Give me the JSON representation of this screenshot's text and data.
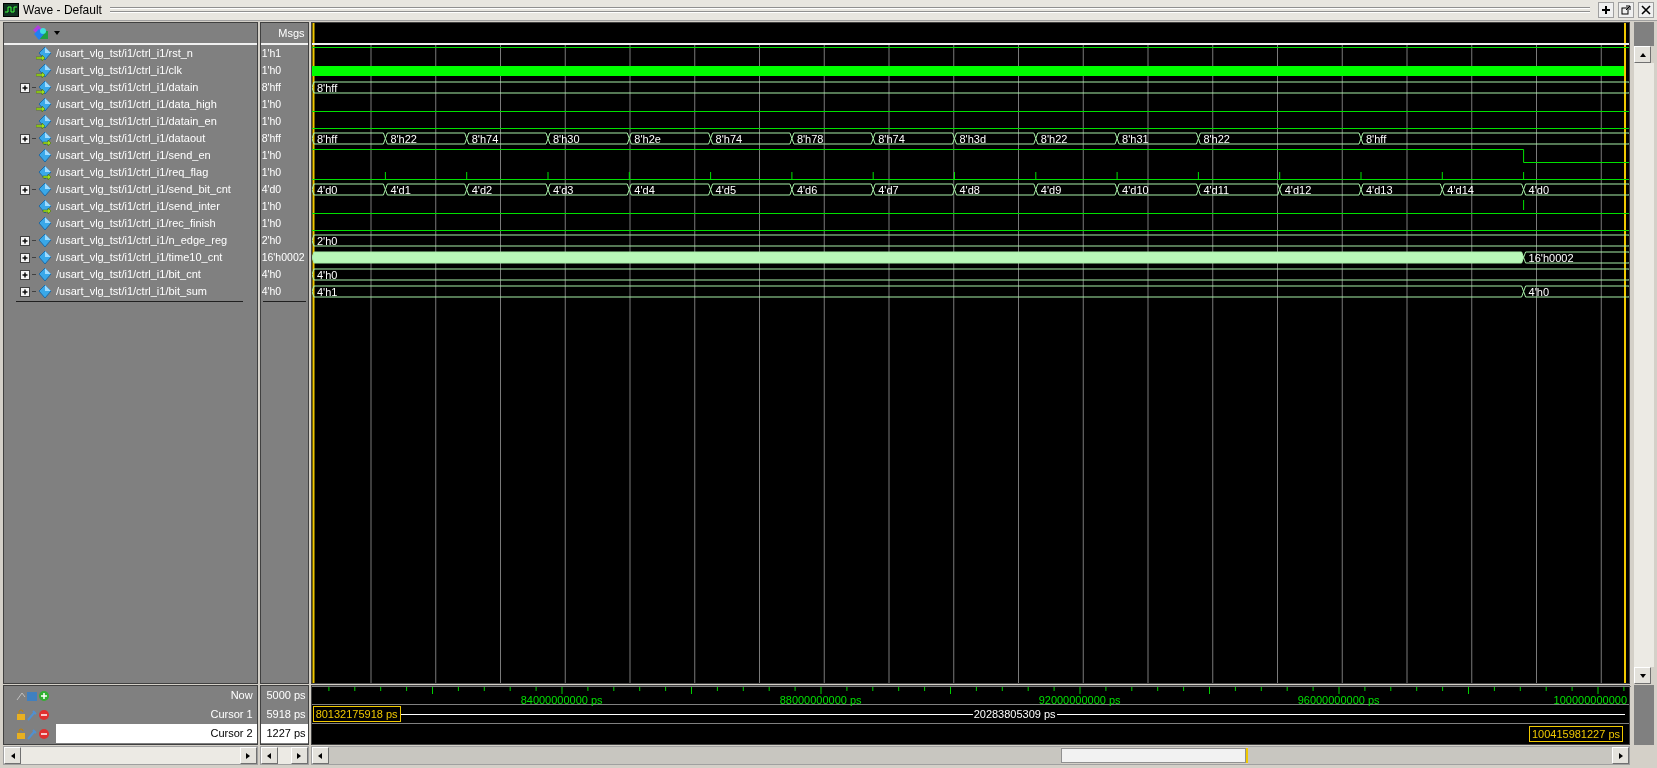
{
  "window": {
    "title": "Wave - Default"
  },
  "header": {
    "values_label": "Msgs"
  },
  "signals": [
    {
      "name": "/usart_vlg_tst/i1/ctrl_i1/rst_n",
      "value": "1'h1",
      "input": true,
      "output": false,
      "kind": "high"
    },
    {
      "name": "/usart_vlg_tst/i1/ctrl_i1/clk",
      "value": "1'h0",
      "input": true,
      "output": false,
      "kind": "clock"
    },
    {
      "name": "/usart_vlg_tst/i1/ctrl_i1/datain",
      "value": "8'hff",
      "input": true,
      "output": false,
      "kind": "bus",
      "expanded": false,
      "segments": [
        {
          "label": "8'hff"
        }
      ]
    },
    {
      "name": "/usart_vlg_tst/i1/ctrl_i1/data_high",
      "value": "1'h0",
      "input": true,
      "output": false,
      "kind": "low"
    },
    {
      "name": "/usart_vlg_tst/i1/ctrl_i1/datain_en",
      "value": "1'h0",
      "input": true,
      "output": false,
      "kind": "low"
    },
    {
      "name": "/usart_vlg_tst/i1/ctrl_i1/dataout",
      "value": "8'hff",
      "input": false,
      "output": true,
      "kind": "bus",
      "expanded": false,
      "segments": [
        {
          "label": "8'hff"
        },
        {
          "label": "8'h22"
        },
        {
          "label": "8'h74"
        },
        {
          "label": "8'h30"
        },
        {
          "label": "8'h2e"
        },
        {
          "label": "8'h74"
        },
        {
          "label": "8'h78"
        },
        {
          "label": "8'h74"
        },
        {
          "label": "8'h3d"
        },
        {
          "label": "8'h22"
        },
        {
          "label": "8'h31"
        },
        {
          "label": "8'h22"
        },
        {
          "label": "8'hff"
        }
      ]
    },
    {
      "name": "/usart_vlg_tst/i1/ctrl_i1/send_en",
      "value": "1'h0",
      "input": false,
      "output": false,
      "kind": "fall"
    },
    {
      "name": "/usart_vlg_tst/i1/ctrl_i1/req_flag",
      "value": "1'h0",
      "input": false,
      "output": true,
      "kind": "pulses"
    },
    {
      "name": "/usart_vlg_tst/i1/ctrl_i1/send_bit_cnt",
      "value": "4'd0",
      "input": false,
      "output": false,
      "kind": "bus",
      "expanded": false,
      "segments": [
        {
          "label": "4'd0"
        },
        {
          "label": "4'd1"
        },
        {
          "label": "4'd2"
        },
        {
          "label": "4'd3"
        },
        {
          "label": "4'd4"
        },
        {
          "label": "4'd5"
        },
        {
          "label": "4'd6"
        },
        {
          "label": "4'd7"
        },
        {
          "label": "4'd8"
        },
        {
          "label": "4'd9"
        },
        {
          "label": "4'd10"
        },
        {
          "label": "4'd11"
        },
        {
          "label": "4'd12"
        },
        {
          "label": "4'd13"
        },
        {
          "label": "4'd14"
        },
        {
          "label": "4'd0"
        }
      ]
    },
    {
      "name": "/usart_vlg_tst/i1/ctrl_i1/send_inter",
      "value": "1'h0",
      "input": false,
      "output": true,
      "kind": "blip"
    },
    {
      "name": "/usart_vlg_tst/i1/ctrl_i1/rec_finish",
      "value": "1'h0",
      "input": false,
      "output": false,
      "kind": "low"
    },
    {
      "name": "/usart_vlg_tst/i1/ctrl_i1/n_edge_reg",
      "value": "2'h0",
      "input": false,
      "output": false,
      "kind": "bus",
      "expanded": false,
      "segments": [
        {
          "label": "2'h0"
        }
      ]
    },
    {
      "name": "/usart_vlg_tst/i1/ctrl_i1/time10_cnt",
      "value": "16'h0002",
      "input": false,
      "output": false,
      "kind": "bus",
      "expanded": false,
      "segments": [
        {
          "kind": "dense"
        },
        {
          "kind": "text",
          "label": "16'h0002"
        }
      ]
    },
    {
      "name": "/usart_vlg_tst/i1/ctrl_i1/bit_cnt",
      "value": "4'h0",
      "input": false,
      "output": false,
      "kind": "bus",
      "expanded": false,
      "segments": [
        {
          "label": "4'h0"
        }
      ]
    },
    {
      "name": "/usart_vlg_tst/i1/ctrl_i1/bit_sum",
      "value": "4'h0",
      "input": false,
      "output": false,
      "kind": "bus",
      "expanded": false,
      "segments": [
        {
          "label": "4'h1"
        },
        {
          "label": "4'h0"
        }
      ]
    }
  ],
  "timeline": {
    "ticks": [
      "84000000000 ps",
      "88000000000 ps",
      "92000000000 ps",
      "96000000000 ps",
      "100000000000"
    ]
  },
  "cursors": [
    {
      "name": "Now",
      "time": "5000 ps",
      "selected": false
    },
    {
      "name": "Cursor 1",
      "time": "5918 ps",
      "selected": false,
      "marker": "80132175918 ps"
    },
    {
      "name": "Cursor 2",
      "time": "1227 ps",
      "selected": true,
      "marker": "100415981227 ps"
    }
  ],
  "cursor_delta": "20283805309 ps"
}
